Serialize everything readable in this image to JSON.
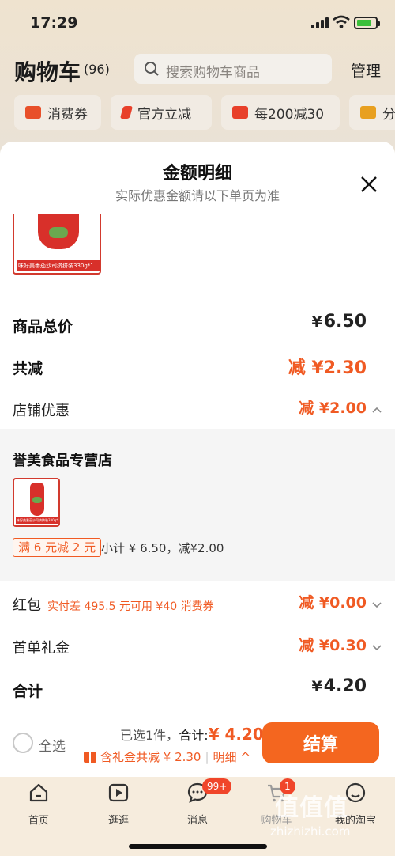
{
  "status_bar": {
    "time": "17:29"
  },
  "cart_header": {
    "title": "购物车",
    "count": "(96)",
    "search_placeholder": "搜索购物车商品",
    "manage_label": "管理"
  },
  "chips": [
    {
      "label": "消费券",
      "color": "#e8502a"
    },
    {
      "label": "官方立减",
      "color": "#e8402a"
    },
    {
      "label": "每200减30",
      "color": "#e8402a"
    },
    {
      "label": "分",
      "color": "#e8a020"
    }
  ],
  "sheet": {
    "title": "金额明细",
    "subtitle": "实际优惠金额请以下单页为准",
    "product_caption": "味好美番茄沙司挤挤装330g*1",
    "rows": {
      "subtotal_label": "商品总价",
      "subtotal_yen": "¥",
      "subtotal_value": "6.50",
      "total_discount_label": "共减",
      "total_discount_value": "减 ¥2.30",
      "store_discount_label": "店铺优惠",
      "store_discount_value": "减 ¥2.00",
      "hongbao_label": "红包",
      "hongbao_note": "实付差 495.5 元可用 ¥40 消费券",
      "hongbao_value": "减 ¥0.00",
      "first_order_label": "首单礼金",
      "first_order_value": "减 ¥0.30",
      "total_label": "合计",
      "total_yen": "¥",
      "total_value": "4.20"
    },
    "store": {
      "name": "誉美食品专营店",
      "thumb_caption": "味好美番茄沙司挤挤装330g*1",
      "promo_tag": "满 6 元减 2 元",
      "promo_text": "小计 ¥ 6.50，减¥2.00"
    }
  },
  "checkout": {
    "select_all": "全选",
    "selected_prefix": "已选1件，",
    "total_label": "合计:",
    "total_amount": "¥ 4.20",
    "discount_text": "含礼金共减 ¥ 2.30",
    "detail_link": "明细 ^",
    "checkout_button": "结算"
  },
  "tabbar": {
    "tabs": [
      {
        "label": "首页",
        "icon": "home-icon"
      },
      {
        "label": "逛逛",
        "icon": "video-icon"
      },
      {
        "label": "消息",
        "icon": "message-icon",
        "badge": "99+"
      },
      {
        "label": "购物车",
        "icon": "cart-icon",
        "badge": "1"
      },
      {
        "label": "我的淘宝",
        "icon": "profile-icon"
      }
    ]
  },
  "watermark": {
    "main": "值值值",
    "sub": "zhizhizhi.com"
  }
}
